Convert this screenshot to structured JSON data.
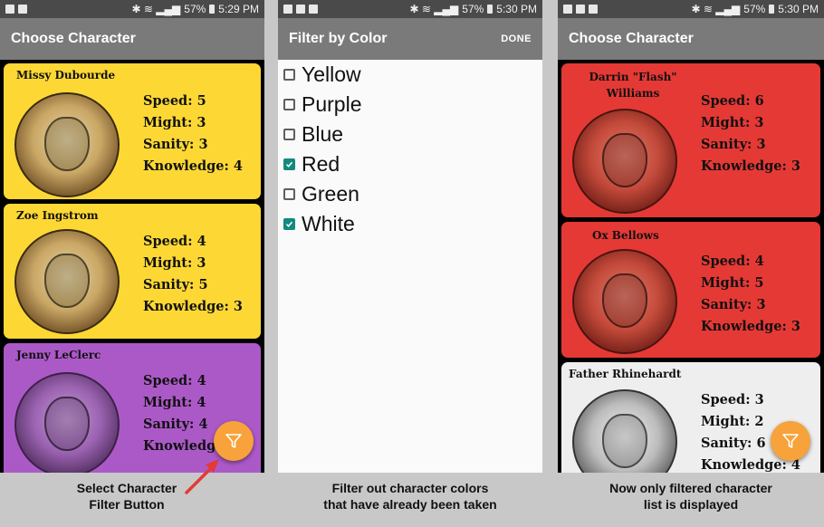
{
  "panels": [
    {
      "status": {
        "battery": "57%",
        "time": "5:29 PM"
      },
      "title": "Choose Character",
      "cards": [
        {
          "name": "Missy Dubourde",
          "color": "#fdd835",
          "stats": [
            "Speed: 5",
            "Might: 3",
            "Sanity: 3",
            "Knowledge: 4"
          ]
        },
        {
          "name": "Zoe Ingstrom",
          "color": "#fdd835",
          "stats": [
            "Speed: 4",
            "Might: 3",
            "Sanity: 5",
            "Knowledge: 3"
          ]
        },
        {
          "name": "Jenny LeClerc",
          "color": "#ac59c8",
          "stats": [
            "Speed: 4",
            "Might: 4",
            "Sanity: 4",
            "Knowledge: 3"
          ]
        }
      ],
      "caption": [
        "Select Character",
        "Filter Button"
      ]
    },
    {
      "status": {
        "battery": "57%",
        "time": "5:30 PM"
      },
      "title": "Filter by Color",
      "done_label": "DONE",
      "options": [
        {
          "label": "Yellow",
          "checked": false
        },
        {
          "label": "Purple",
          "checked": false
        },
        {
          "label": "Blue",
          "checked": false
        },
        {
          "label": "Red",
          "checked": true
        },
        {
          "label": "Green",
          "checked": false
        },
        {
          "label": "White",
          "checked": true
        }
      ],
      "caption": [
        "Filter out character colors",
        "that have already been taken"
      ]
    },
    {
      "status": {
        "battery": "57%",
        "time": "5:30 PM"
      },
      "title": "Choose Character",
      "cards": [
        {
          "name_lines": [
            "Darrin \"Flash\"",
            "Williams"
          ],
          "color": "#e53935",
          "stats": [
            "Speed: 6",
            "Might: 3",
            "Sanity: 3",
            "Knowledge: 3"
          ]
        },
        {
          "name": "Ox Bellows",
          "color": "#e53935",
          "stats": [
            "Speed: 4",
            "Might: 5",
            "Sanity: 3",
            "Knowledge: 3"
          ]
        },
        {
          "name": "Father Rhinehardt",
          "color": "#eeeeee",
          "stats": [
            "Speed: 3",
            "Might: 2",
            "Sanity: 6",
            "Knowledge: 4"
          ]
        }
      ],
      "caption": [
        "Now only filtered character",
        "list is displayed"
      ]
    }
  ],
  "colors": {
    "fab": "#f7a23a",
    "appbar": "#7a7a7a",
    "statusbar": "#4a4a4a",
    "checkbox_checked": "#138a7e",
    "arrow": "#e53935"
  },
  "icons": [
    "filter-icon",
    "checkbox-check-icon",
    "bluetooth-icon",
    "wifi-icon",
    "signal-icon",
    "battery-icon",
    "arrow-annotation"
  ]
}
